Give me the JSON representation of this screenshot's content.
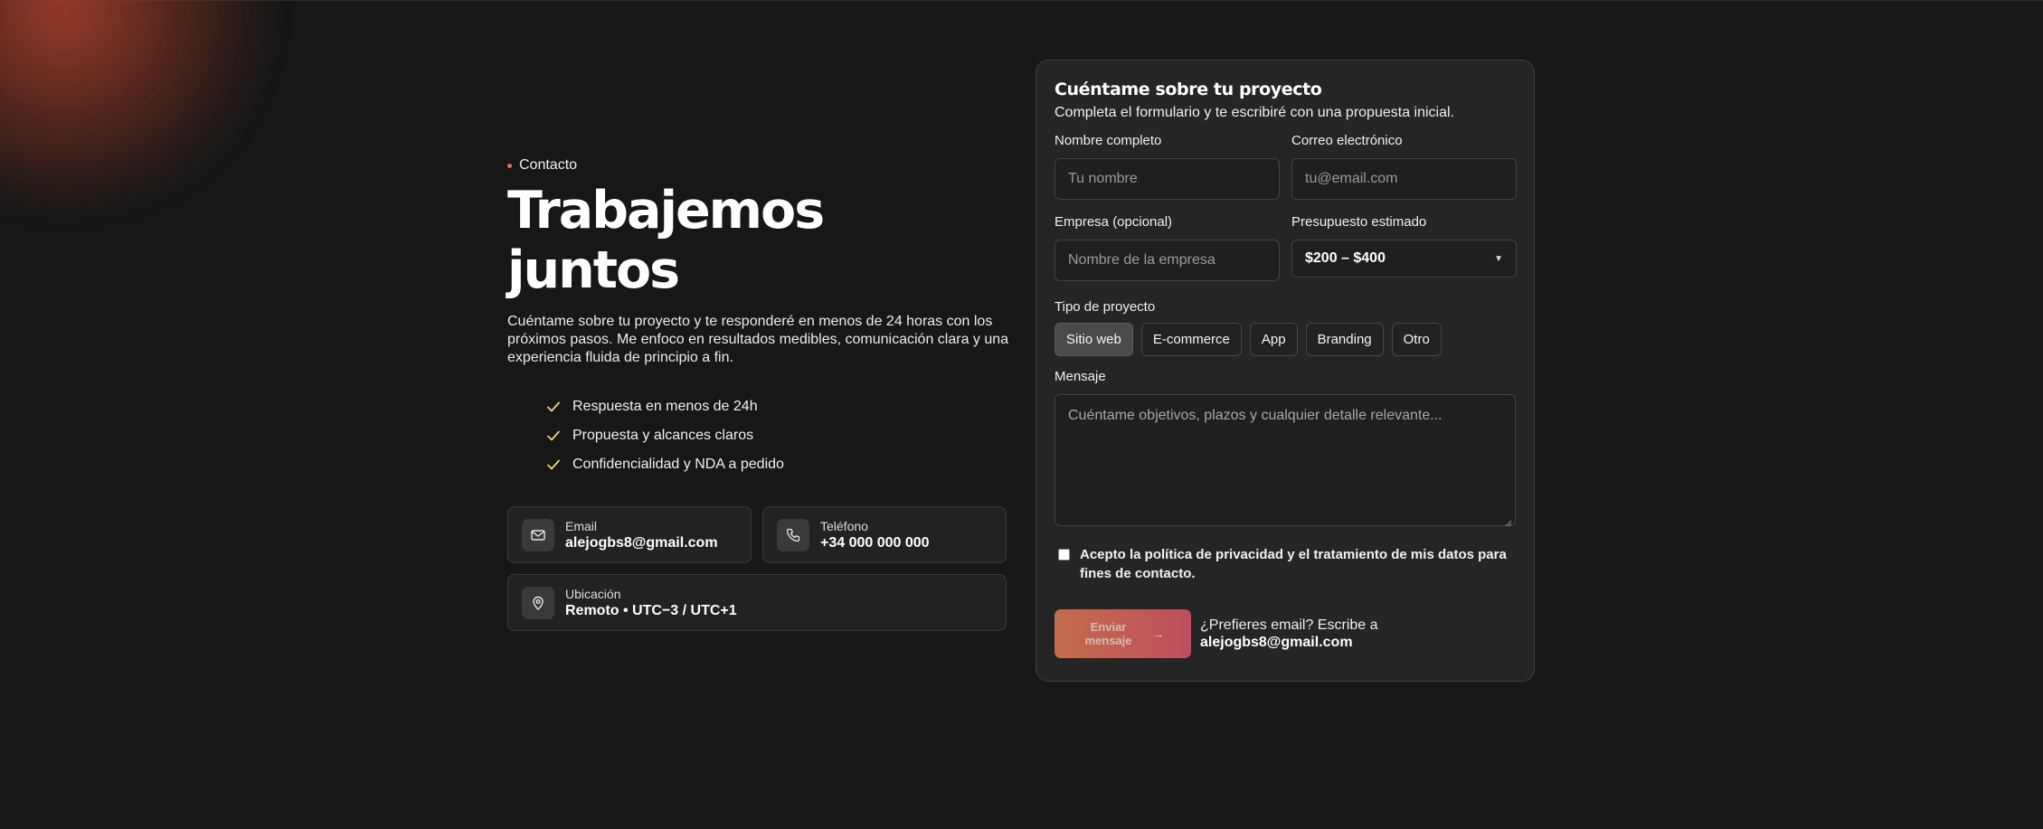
{
  "hero": {
    "eyebrow": "Contacto",
    "title": "Trabajemos juntos",
    "lead": "Cuéntame sobre tu proyecto y te responderé en menos de 24 horas con los próximos pasos. Me enfoco en resultados medibles, comunicación clara y una experiencia fluida de principio a fin.",
    "benefits": [
      "Respuesta en menos de 24h",
      "Propuesta y alcances claros",
      "Confidencialidad y NDA a pedido"
    ]
  },
  "contact_cards": {
    "email": {
      "label": "Email",
      "value": "alejogbs8@gmail.com",
      "icon": "mail-icon"
    },
    "phone": {
      "label": "Teléfono",
      "value": "+34 000 000 000",
      "icon": "phone-icon"
    },
    "location": {
      "label": "Ubicación",
      "value": "Remoto • UTC−3 / UTC+1",
      "icon": "map-pin-icon"
    }
  },
  "form": {
    "title": "Cuéntame sobre tu proyecto",
    "subtitle": "Completa el formulario y te escribiré con una propuesta inicial.",
    "name": {
      "label": "Nombre completo",
      "placeholder": "Tu nombre",
      "value": ""
    },
    "email": {
      "label": "Correo electrónico",
      "placeholder": "tu@email.com",
      "value": ""
    },
    "company": {
      "label": "Empresa (opcional)",
      "placeholder": "Nombre de la empresa",
      "value": ""
    },
    "budget": {
      "label": "Presupuesto estimado",
      "value": "$200 – $400"
    },
    "project_type": {
      "label": "Tipo de proyecto",
      "options": [
        "Sitio web",
        "E-commerce",
        "App",
        "Branding",
        "Otro"
      ],
      "selected": "Sitio web"
    },
    "message": {
      "label": "Mensaje",
      "placeholder": "Cuéntame objetivos, plazos y cualquier detalle relevante...",
      "value": ""
    },
    "consent": {
      "text": "Acepto la política de privacidad y el tratamiento de mis datos para fines de contacto.",
      "checked": false
    },
    "submit_label": "Enviar mensaje",
    "alt_prefix": "¿Prefieres email? Escribe a",
    "alt_email": "alejogbs8@gmail.com"
  },
  "colors": {
    "background": "#171717",
    "panel": "#252525",
    "accent_start": "#e07a52",
    "accent_end": "#d9566a",
    "check": "#f2d28a"
  }
}
